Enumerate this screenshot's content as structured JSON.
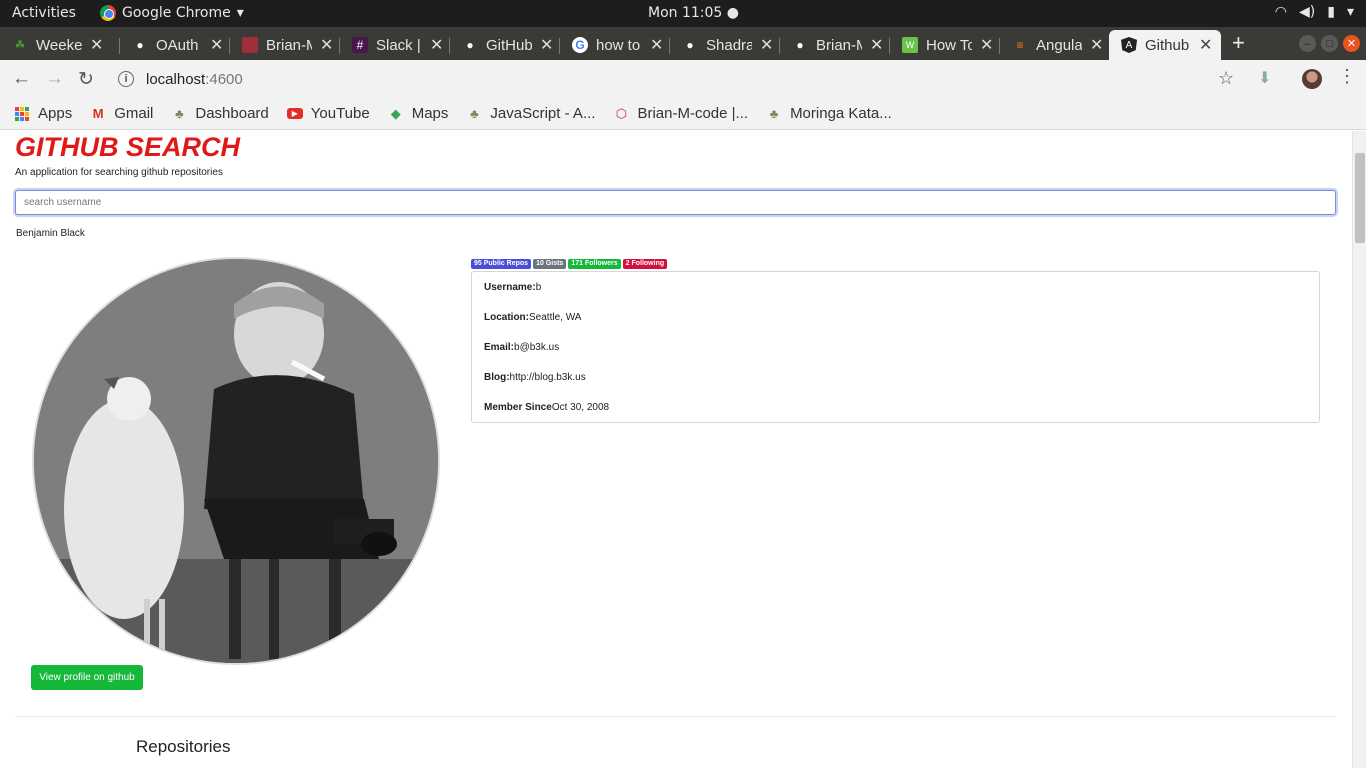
{
  "system_bar": {
    "activities": "Activities",
    "app_name": "Google Chrome",
    "clock": "Mon 11:05 ●"
  },
  "tabs": [
    {
      "title": "Weekend",
      "icon": "tab-favicon"
    },
    {
      "title": "OAuth",
      "icon": "github-icon"
    },
    {
      "title": "Brian-M",
      "icon": "tab-favicon"
    },
    {
      "title": "Slack |",
      "icon": "slack-icon"
    },
    {
      "title": "GitHub",
      "icon": "github-icon"
    },
    {
      "title": "how to",
      "icon": "google-icon"
    },
    {
      "title": "Shadrack",
      "icon": "github-icon"
    },
    {
      "title": "Brian-M",
      "icon": "github-icon"
    },
    {
      "title": "How To",
      "icon": "tab-favicon"
    },
    {
      "title": "Angular",
      "icon": "tab-favicon"
    },
    {
      "title": "Github",
      "icon": "angular-icon"
    }
  ],
  "address_bar": {
    "host": "localhost",
    "port": ":4600"
  },
  "bookmarks": [
    {
      "label": "Apps"
    },
    {
      "label": "Gmail"
    },
    {
      "label": "Dashboard"
    },
    {
      "label": "YouTube"
    },
    {
      "label": "Maps"
    },
    {
      "label": "JavaScript - A..."
    },
    {
      "label": "Brian-M-code |..."
    },
    {
      "label": "Moringa Kata..."
    }
  ],
  "app": {
    "title": "GITHUB SEARCH",
    "subtitle": "An application for searching github repositories",
    "search_placeholder": "search username",
    "full_name": "Benjamin Black",
    "view_button": "View profile on github",
    "repositories_heading": "Repositories"
  },
  "badges": [
    {
      "label": "95 Public Repos",
      "color": "#4a50d6"
    },
    {
      "label": "10 Gists",
      "color": "#6c757d"
    },
    {
      "label": "171 Followers",
      "color": "#16b83a"
    },
    {
      "label": "2 Following",
      "color": "#d4103f"
    }
  ],
  "profile": {
    "username_label": "Username:",
    "username": "b",
    "location_label": "Location:",
    "location": "Seattle, WA",
    "email_label": "Email:",
    "email": "b@b3k.us",
    "blog_label": "Blog:",
    "blog": "http://blog.b3k.us",
    "member_since_label": "Member Since",
    "member_since": "Oct 30, 2008"
  }
}
